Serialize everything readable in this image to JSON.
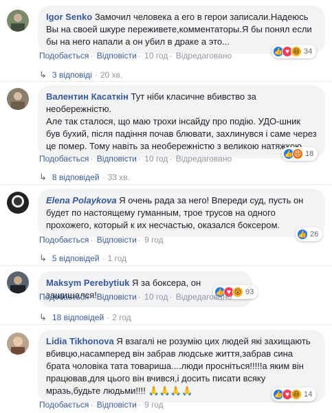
{
  "comments": [
    {
      "author": "Igor Senko",
      "text": "Замочил человека а его в герои записали.Надеюсь Вы на своей шкуре переживете,комментаторы.Я бы понял если бы на него напали а он убил в драке а это...",
      "like": "Подобається",
      "reply": "Відповісти",
      "time": "10 год",
      "edited": "Відредаговано",
      "reactions": [
        "like",
        "love",
        "haha"
      ],
      "reaction_count": "34",
      "replies_label": "3 відповіді",
      "replies_time": "20 хв."
    },
    {
      "author": "Валентин Касаткін",
      "text": "Тут ніби класичне вбивство за необережністю.\nАле так сталося, що маю трохи інсайду про подію. УДО-шник був бухий, після падіння почав блювати, захлинувся і саме через це помер. Тому навіть за необережністю з великою натяжкою.",
      "like": "Подобається",
      "reply": "Відповісти",
      "time": "10 год",
      "edited": "Відредаговано",
      "reactions": [
        "like",
        "angry"
      ],
      "reaction_count": "18",
      "replies_label": "8 відповідей",
      "replies_time": "33 хв."
    },
    {
      "author": "Elena Polaykova",
      "text": "Я очень рада за него! Впереди суд, пусть он будет по настоящему гуманным, трое трусов на одного прохожего, который к их несчастью, оказался боксером.",
      "like": "Подобається",
      "reply": "Відповісти",
      "time": "9 год",
      "reactions": [
        "like"
      ],
      "reaction_count": "26",
      "replies_label": "5 відповідей",
      "replies_time": "1 год"
    },
    {
      "author": "Maksym Perebytiuk",
      "text": "Я за боксера, он защищался!",
      "like": "Подобається",
      "reply": "Відповісти",
      "time": "10 год",
      "edited": "Відредаговано",
      "reactions": [
        "like",
        "love",
        "wow"
      ],
      "reaction_count": "93",
      "replies_label": "18 відповідей",
      "replies_time": "2 год"
    },
    {
      "author": "Lidia Tikhonova",
      "text": "Я взагалі не розумію цих людей які захищають вбивцю,насамперед він забрав людське життя,забрав сина брата чоловіка тата товариша....люди просніться!!!!!а яким він працював,для цього він вчився,і досить писати всяку мразь,будьте людьми!!!! 🙏🙏🙏🙏",
      "like": "Подобається",
      "reply": "Відповісти",
      "time": "9 год",
      "reactions": [
        "like",
        "love",
        "haha"
      ],
      "reaction_count": "14"
    }
  ],
  "icons": {
    "reply_arrow": "reply-arrow-icon",
    "like": "like-icon",
    "love": "love-icon",
    "haha": "haha-icon",
    "wow": "wow-icon",
    "angry": "angry-icon"
  }
}
